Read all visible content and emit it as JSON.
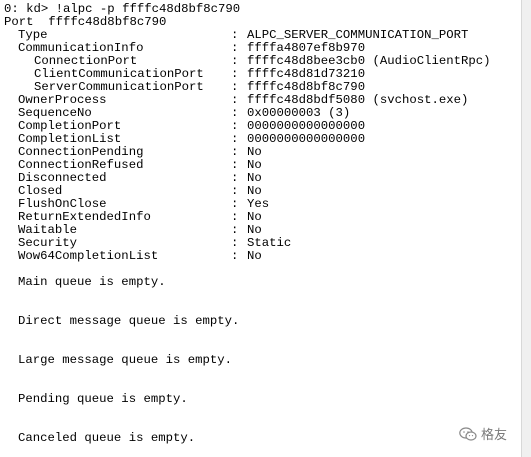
{
  "prompt": "0: kd> !alpc -p ffffc48d8bf8c790",
  "port_header": "Port  ffffc48d8bf8c790",
  "fields": [
    {
      "key": "Type",
      "value": "ALPC_SERVER_COMMUNICATION_PORT",
      "indent": 0
    },
    {
      "key": "CommunicationInfo",
      "value": "ffffa4807ef8b970",
      "indent": 0
    },
    {
      "key": "ConnectionPort",
      "value": "ffffc48d8bee3cb0 (AudioClientRpc)",
      "indent": 1
    },
    {
      "key": "ClientCommunicationPort",
      "value": "ffffc48d81d73210",
      "indent": 1
    },
    {
      "key": "ServerCommunicationPort",
      "value": "ffffc48d8bf8c790",
      "indent": 1
    },
    {
      "key": "OwnerProcess",
      "value": "ffffc48d8bdf5080 (svchost.exe)",
      "indent": 0
    },
    {
      "key": "SequenceNo",
      "value": "0x00000003 (3)",
      "indent": 0
    },
    {
      "key": "CompletionPort",
      "value": "0000000000000000",
      "indent": 0
    },
    {
      "key": "CompletionList",
      "value": "0000000000000000",
      "indent": 0
    },
    {
      "key": "ConnectionPending",
      "value": "No",
      "indent": 0
    },
    {
      "key": "ConnectionRefused",
      "value": "No",
      "indent": 0
    },
    {
      "key": "Disconnected",
      "value": "No",
      "indent": 0
    },
    {
      "key": "Closed",
      "value": "No",
      "indent": 0
    },
    {
      "key": "FlushOnClose",
      "value": "Yes",
      "indent": 0
    },
    {
      "key": "ReturnExtendedInfo",
      "value": "No",
      "indent": 0
    },
    {
      "key": "Waitable",
      "value": "No",
      "indent": 0
    },
    {
      "key": "Security",
      "value": "Static",
      "indent": 0
    },
    {
      "key": "Wow64CompletionList",
      "value": "No",
      "indent": 0
    }
  ],
  "separator": ":",
  "queues": [
    "Main queue is empty.",
    "Direct message queue is empty.",
    "Large message queue is empty.",
    "Pending queue is empty.",
    "Canceled queue is empty."
  ],
  "watermark": {
    "text": "格友",
    "icon": "wechat-icon",
    "color": "#7a7a7a"
  }
}
